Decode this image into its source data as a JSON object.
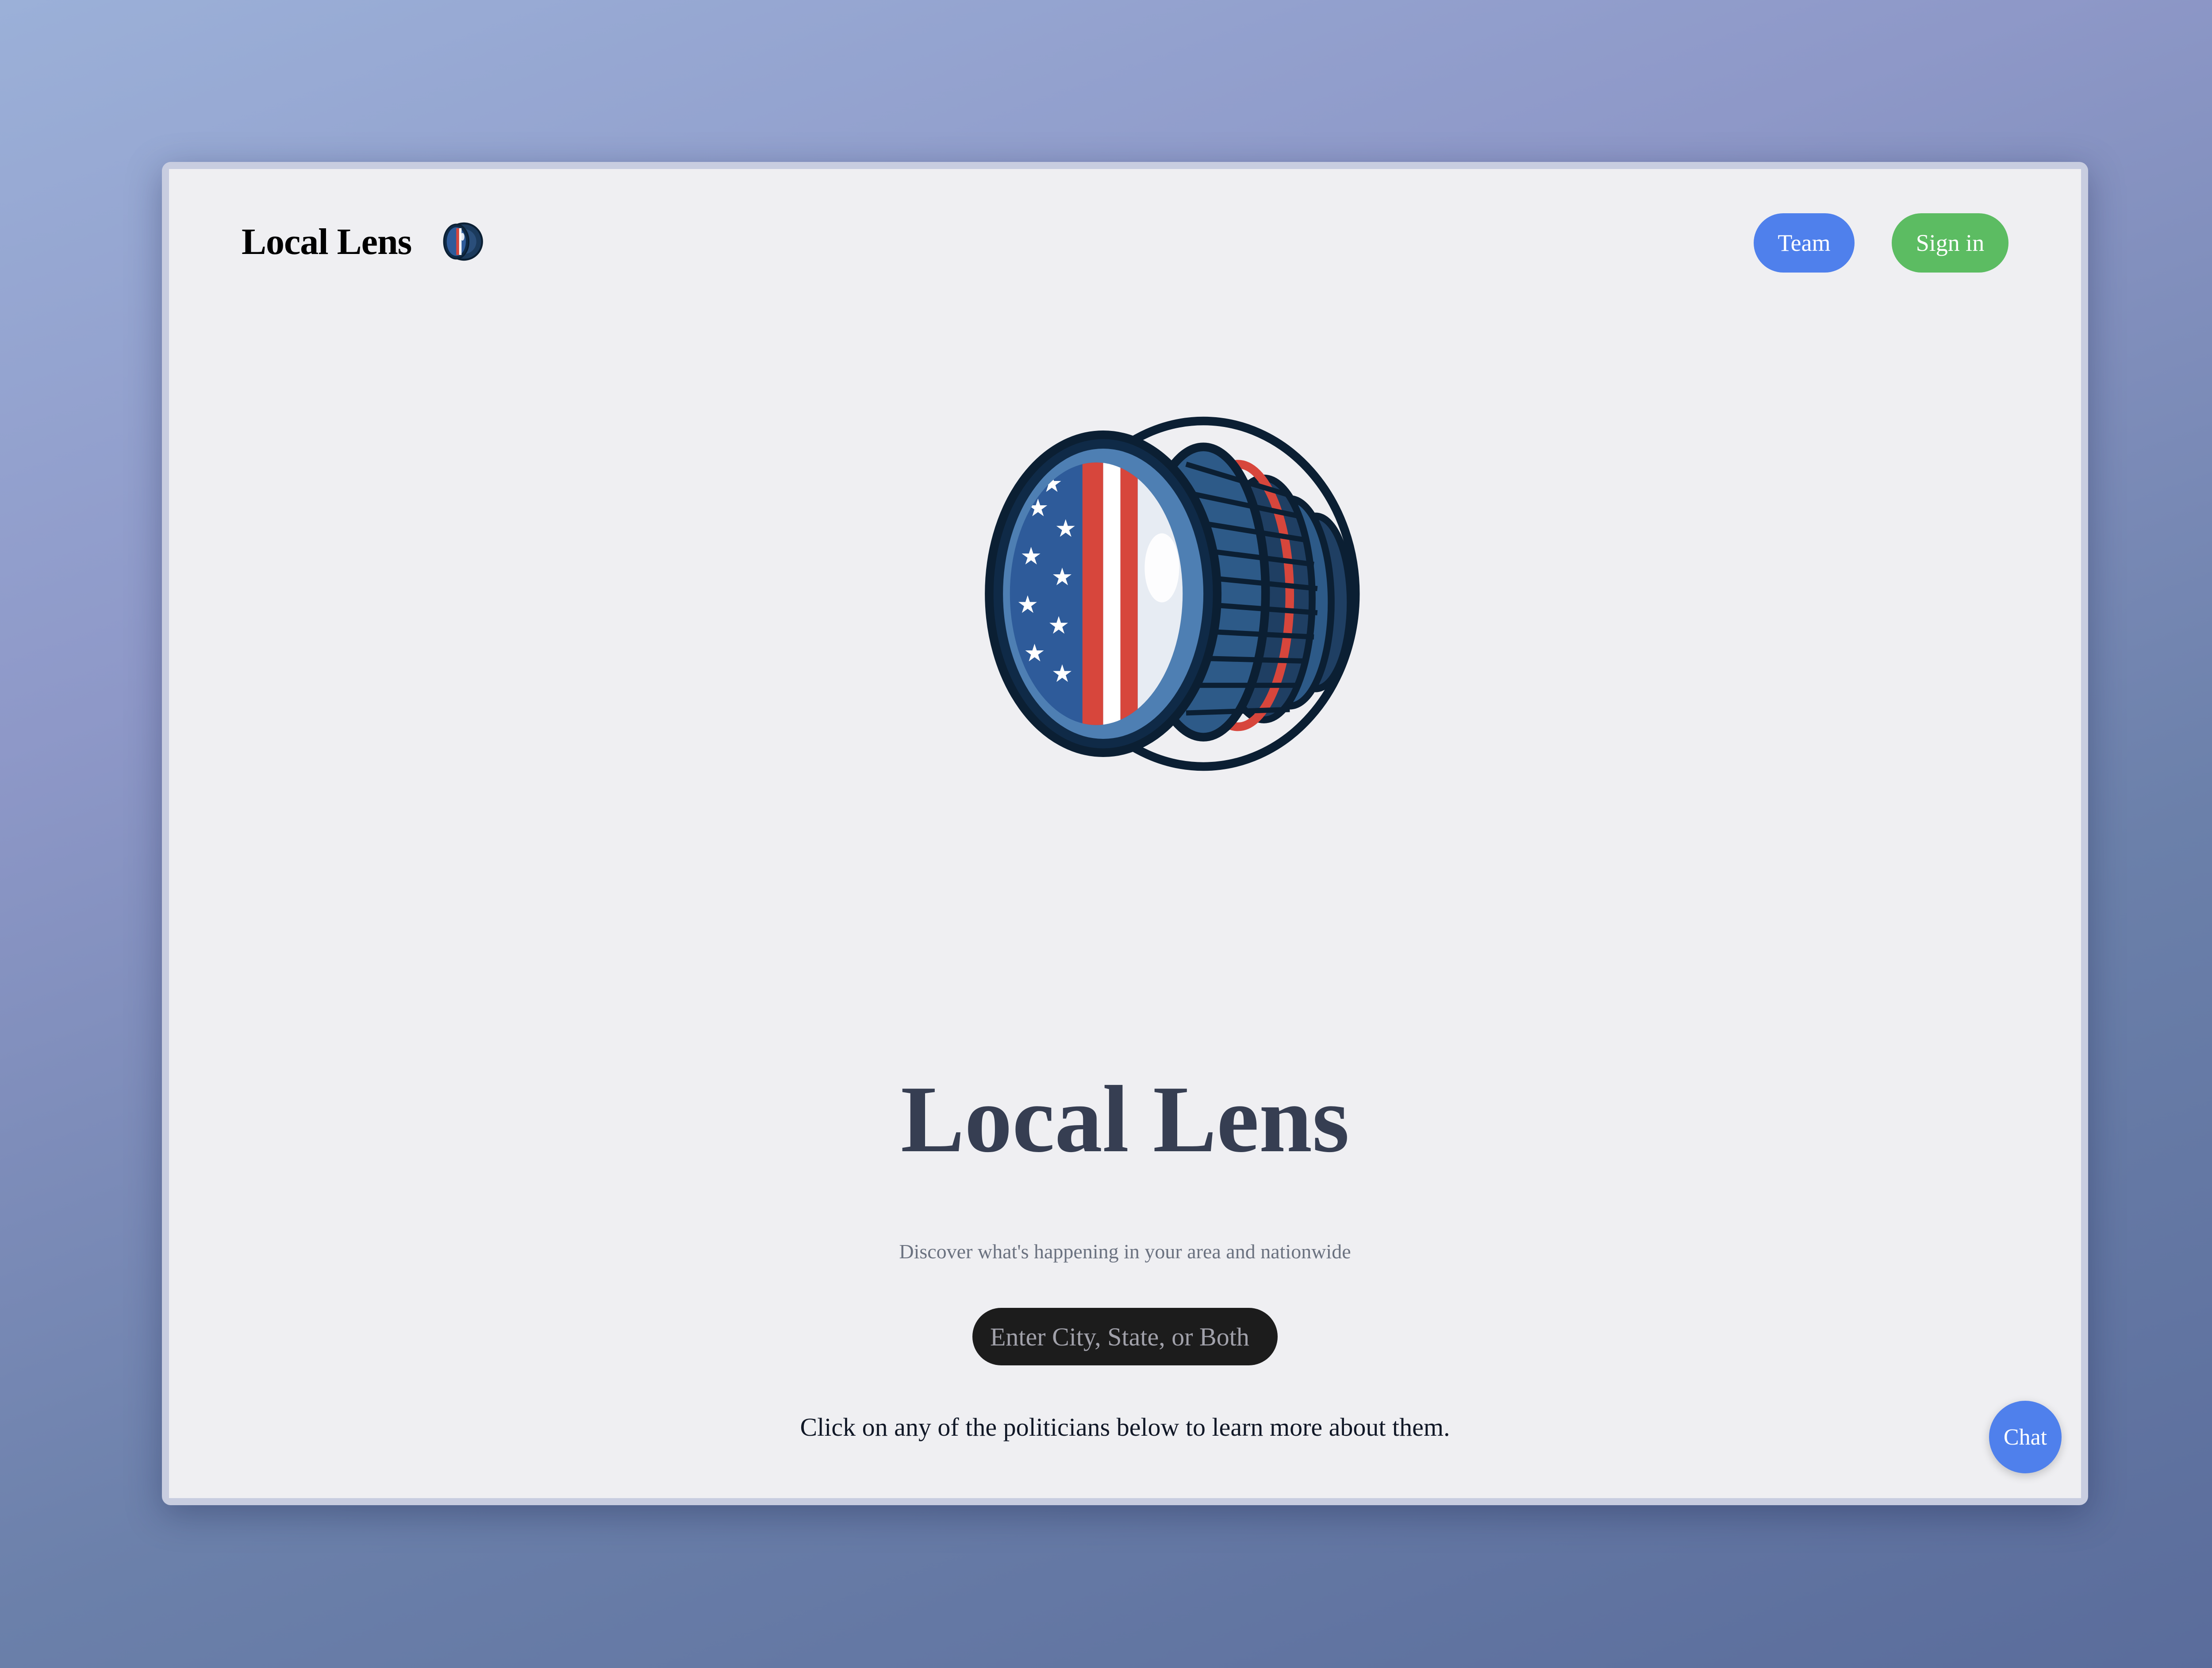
{
  "nav": {
    "brand_title": "Local Lens",
    "logo_icon": "camera-lens-flag-icon",
    "team_label": "Team",
    "signin_label": "Sign in"
  },
  "hero": {
    "logo_icon": "camera-lens-flag-icon",
    "title": "Local Lens",
    "subtitle": "Discover what's happening in your area and nationwide",
    "search": {
      "placeholder": "Enter City, State, or Both",
      "value": ""
    },
    "instructions": "Click on any of the politicians below to learn more about them."
  },
  "politician_cards": [
    {
      "avatar_icon": "person-avatar-icon"
    },
    {
      "avatar_icon": "person-avatar-icon"
    },
    {
      "avatar_icon": "person-avatar-icon"
    }
  ],
  "chat": {
    "label": "Chat"
  },
  "colors": {
    "team_button": "#4f80ec",
    "signin_button": "#5cbc62",
    "chat_button": "#4f80ec",
    "title_text": "#363e52",
    "page_background": "#efeff2",
    "search_background": "#1c1c1c"
  }
}
